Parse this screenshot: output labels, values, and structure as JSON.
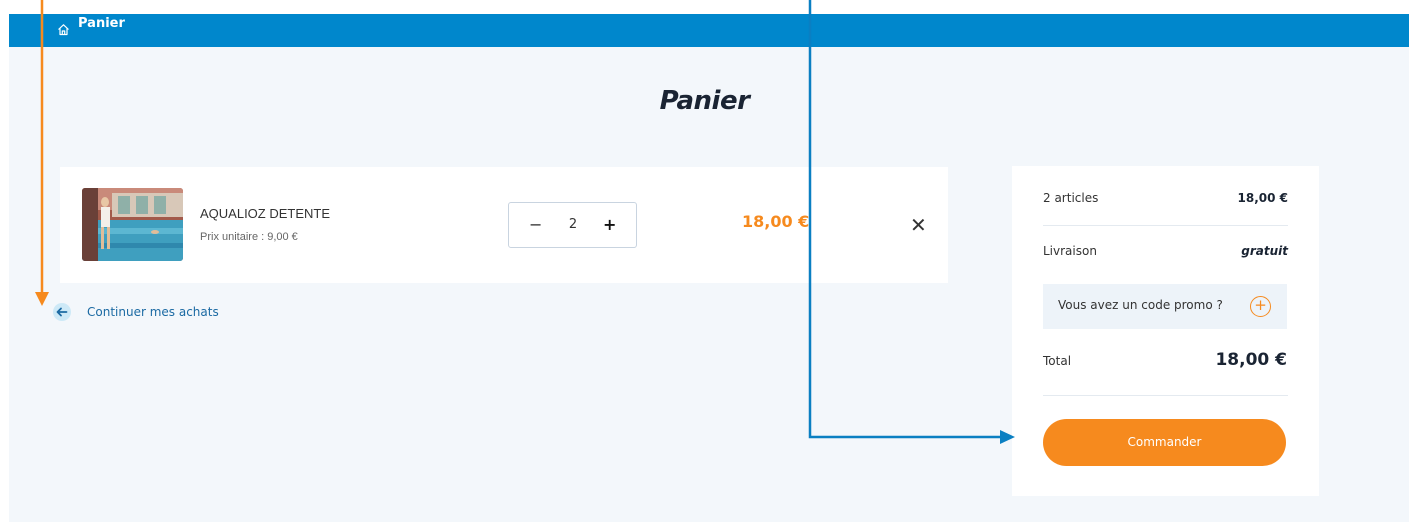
{
  "breadcrumb": {
    "home_icon": "home-icon",
    "current": "Panier"
  },
  "page": {
    "title": "Panier"
  },
  "cart": {
    "items": [
      {
        "name": "AQUALIOZ DETENTE",
        "unit_label": "Prix unitaire :",
        "unit_price": "9,00 €",
        "quantity": "2",
        "price": "18,00 €",
        "minus": "−",
        "plus": "+",
        "remove": "✕"
      }
    ],
    "continue_label": "Continuer mes achats"
  },
  "summary": {
    "articles_label": "2 articles",
    "articles_value": "18,00 €",
    "delivery_label": "Livraison",
    "delivery_value": "gratuit",
    "promo_label": "Vous avez un code promo ?",
    "promo_icon": "+",
    "total_label": "Total",
    "total_value": "18,00 €",
    "order_button": "Commander"
  },
  "colors": {
    "topbar": "#0087cc",
    "accent": "#f68a1e",
    "background": "#f3f7fb",
    "annotation_orange": "#f68a1e",
    "annotation_blue": "#0a7fc2"
  }
}
